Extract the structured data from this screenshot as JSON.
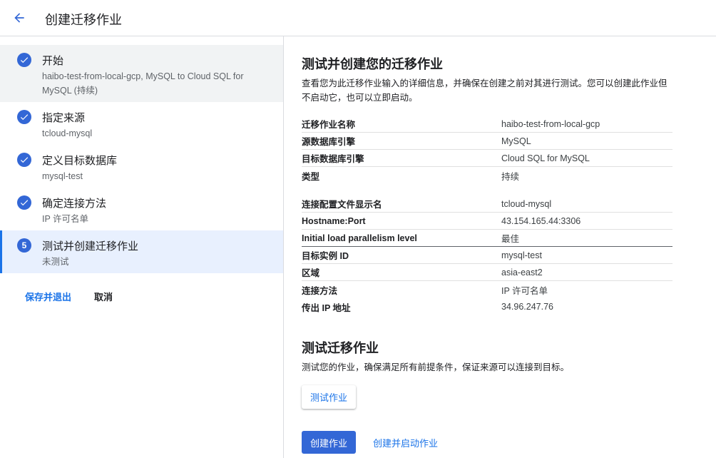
{
  "header": {
    "title": "创建迁移作业"
  },
  "steps": [
    {
      "title": "开始",
      "subtitle": "haibo-test-from-local-gcp, MySQL to Cloud SQL for MySQL (持续)",
      "status": "done"
    },
    {
      "title": "指定来源",
      "subtitle": "tcloud-mysql",
      "status": "done"
    },
    {
      "title": "定义目标数据库",
      "subtitle": "mysql-test",
      "status": "done"
    },
    {
      "title": "确定连接方法",
      "subtitle": "IP 许可名单",
      "status": "done"
    },
    {
      "title": "测试并创建迁移作业",
      "subtitle": "未测试",
      "status": "active",
      "number": "5"
    }
  ],
  "sidebar_actions": {
    "save_exit": "保存并退出",
    "cancel": "取消"
  },
  "main": {
    "title": "测试并创建您的迁移作业",
    "description": "查看您为此迁移作业输入的详细信息，并确保在创建之前对其进行测试。您可以创建此作业但不启动它，也可以立即启动。",
    "details_group1": [
      {
        "key": "迁移作业名称",
        "value": "haibo-test-from-local-gcp"
      },
      {
        "key": "源数据库引擎",
        "value": "MySQL"
      },
      {
        "key": "目标数据库引擎",
        "value": "Cloud SQL for MySQL"
      },
      {
        "key": "类型",
        "value": "持续"
      }
    ],
    "details_group2": [
      {
        "key": "连接配置文件显示名",
        "value": "tcloud-mysql"
      },
      {
        "key": "Hostname:Port",
        "value": "43.154.165.44:3306"
      },
      {
        "key": "Initial load parallelism level",
        "value": "最佳"
      },
      {
        "key": "目标实例 ID",
        "value": "mysql-test"
      },
      {
        "key": "区域",
        "value": "asia-east2"
      },
      {
        "key": "连接方法",
        "value": "IP 许可名单"
      },
      {
        "key": "传出 IP 地址",
        "value": "34.96.247.76"
      }
    ],
    "test_title": "测试迁移作业",
    "test_description": "测试您的作业，确保满足所有前提条件，保证来源可以连接到目标。",
    "test_button": "测试作业",
    "create_button": "创建作业",
    "create_start_button": "创建并启动作业"
  },
  "colors": {
    "accent": "#1a73e8",
    "primary_button": "#3367d6",
    "active_step_bg": "#e8f0fe"
  }
}
